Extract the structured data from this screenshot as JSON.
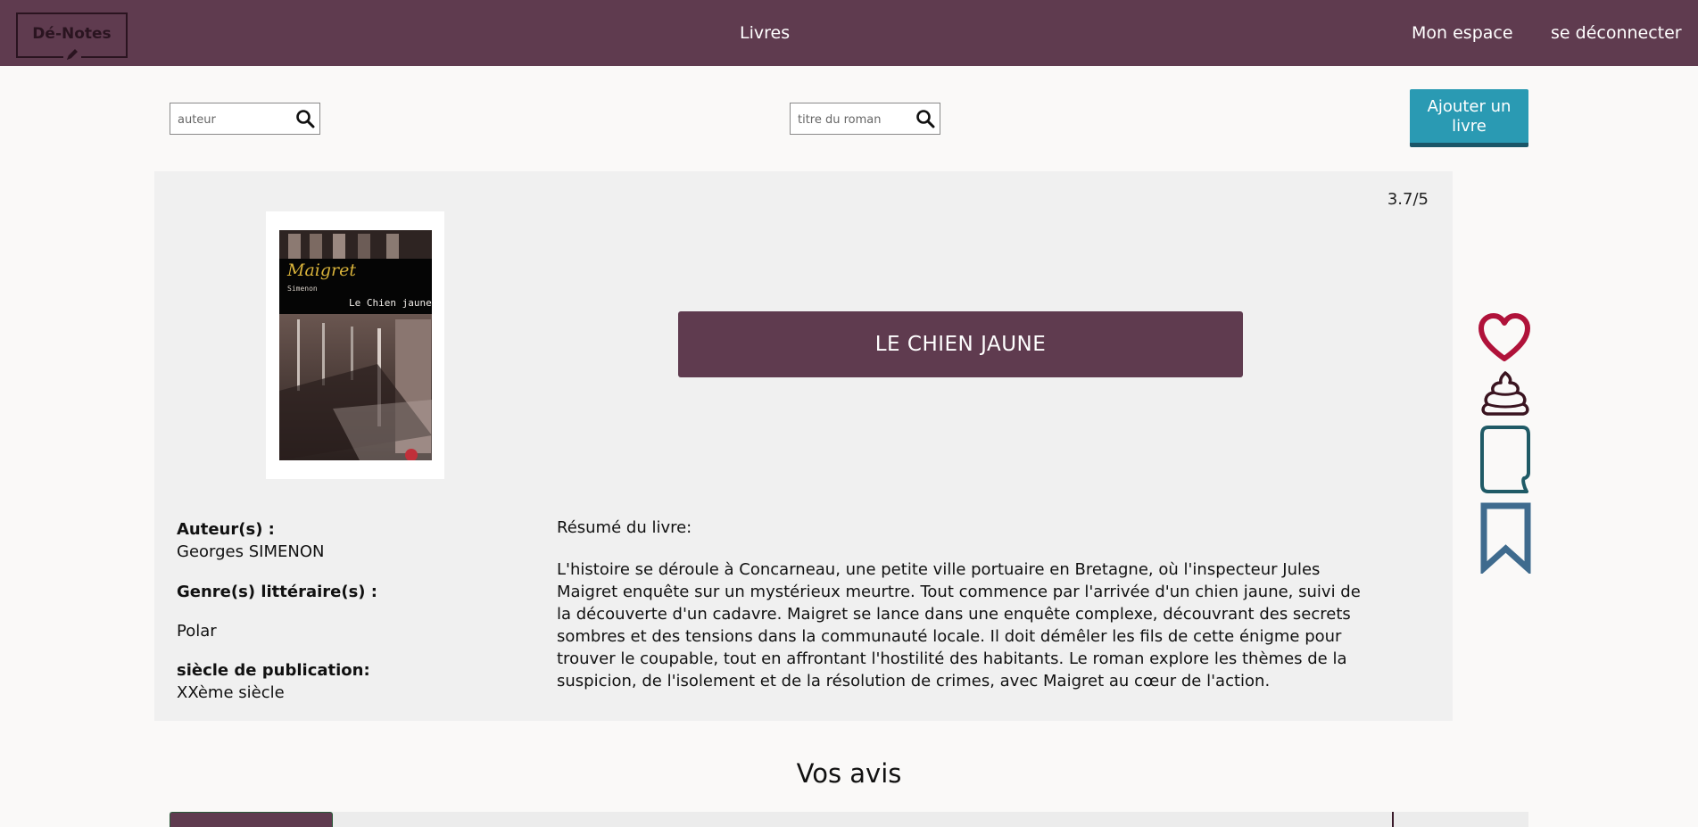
{
  "navbar": {
    "logo_text": "Dé-Notes",
    "links": {
      "books": "Livres",
      "my_space": "Mon espace",
      "logout": "se déconnecter"
    },
    "bg_color": "#5f3b4f"
  },
  "search": {
    "author_placeholder": "auteur",
    "title_placeholder": "titre du roman",
    "icon": "search-icon"
  },
  "add_book_button": {
    "label_line1": "Ajouter un",
    "label_line2": "livre",
    "color": "#2a9ab3"
  },
  "book": {
    "rating": "3.7/5",
    "title": "LE CHIEN JAUNE",
    "cover": {
      "series": "Maigret",
      "author": "Simenon",
      "title": "Le Chien jaune"
    },
    "author_label": "Auteur(s) :",
    "author": "Georges SIMENON",
    "genre_label": "Genre(s) littéraire(s) :",
    "genre": "Polar",
    "century_label": "siècle de publication:",
    "century": "XXème siècle",
    "summary_label": "Résumé du livre:",
    "summary": "L'histoire se déroule à Concarneau, une petite ville portuaire en Bretagne, où l'inspecteur Jules Maigret enquête sur un mystérieux meurtre. Tout commence par l'arrivée d'un chien jaune, suivi de la découverte d'un cadavre. Maigret se lance dans une enquête complexe, découvrant des secrets sombres et des tensions dans la communauté locale. Il doit démêler les fils de cette énigme pour trouver le coupable, tout en affrontant l'hostilité des habitants. Le roman explore les thèmes de la suspicion, de l'isolement et de la résolution de crimes, avec Maigret au cœur de l'action."
  },
  "side_actions": {
    "like": {
      "icon": "heart-icon",
      "color": "#b0123a"
    },
    "dislike": {
      "icon": "poop-icon",
      "color": "#3a1420"
    },
    "review": {
      "icon": "note-icon",
      "color": "#1f5a66"
    },
    "bookmark": {
      "icon": "bookmark-icon",
      "color": "#3f6b8e"
    }
  },
  "reviews": {
    "title": "Vos avis"
  }
}
